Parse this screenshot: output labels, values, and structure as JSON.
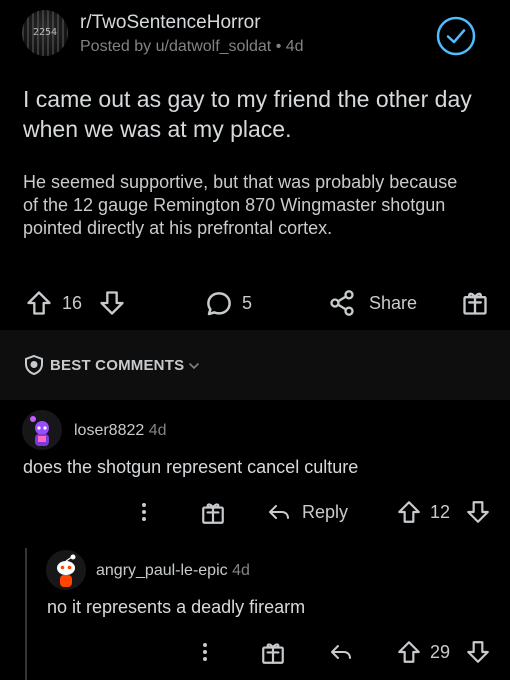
{
  "post": {
    "subreddit": "r/TwoSentenceHorror",
    "subreddit_avatar_text": "2254",
    "posted_by": "Posted by u/datwolf_soldat",
    "age": "4d",
    "title": "I came out as gay to my friend the other day when we was at my place.",
    "body": "He seemed supportive, but that was probably because of the 12 gauge Remington 870 Wingmaster shotgun pointed directly at his prefrontal cortex.",
    "score": "16",
    "comment_count": "5",
    "share_label": "Share"
  },
  "comments_header": {
    "sort_label": "BEST COMMENTS"
  },
  "comments": [
    {
      "author": "loser8822",
      "age": "4d",
      "body": "does the shotgun represent cancel culture",
      "reply_label": "Reply",
      "score": "12"
    },
    {
      "author": "angry_paul-le-epic",
      "age": "4d",
      "body": "no it represents a deadly firearm",
      "score": "29"
    }
  ],
  "colors": {
    "background": "#000000",
    "text_primary": "#d7dadc",
    "text_secondary": "#818384",
    "joined_badge": "#4fbcff"
  },
  "icons": [
    "upvote-icon",
    "downvote-icon",
    "comment-icon",
    "share-icon",
    "award-icon",
    "mod-shield-icon",
    "chevron-down-icon",
    "overflow-dots-icon",
    "reply-icon",
    "checkmark-badge-icon"
  ]
}
